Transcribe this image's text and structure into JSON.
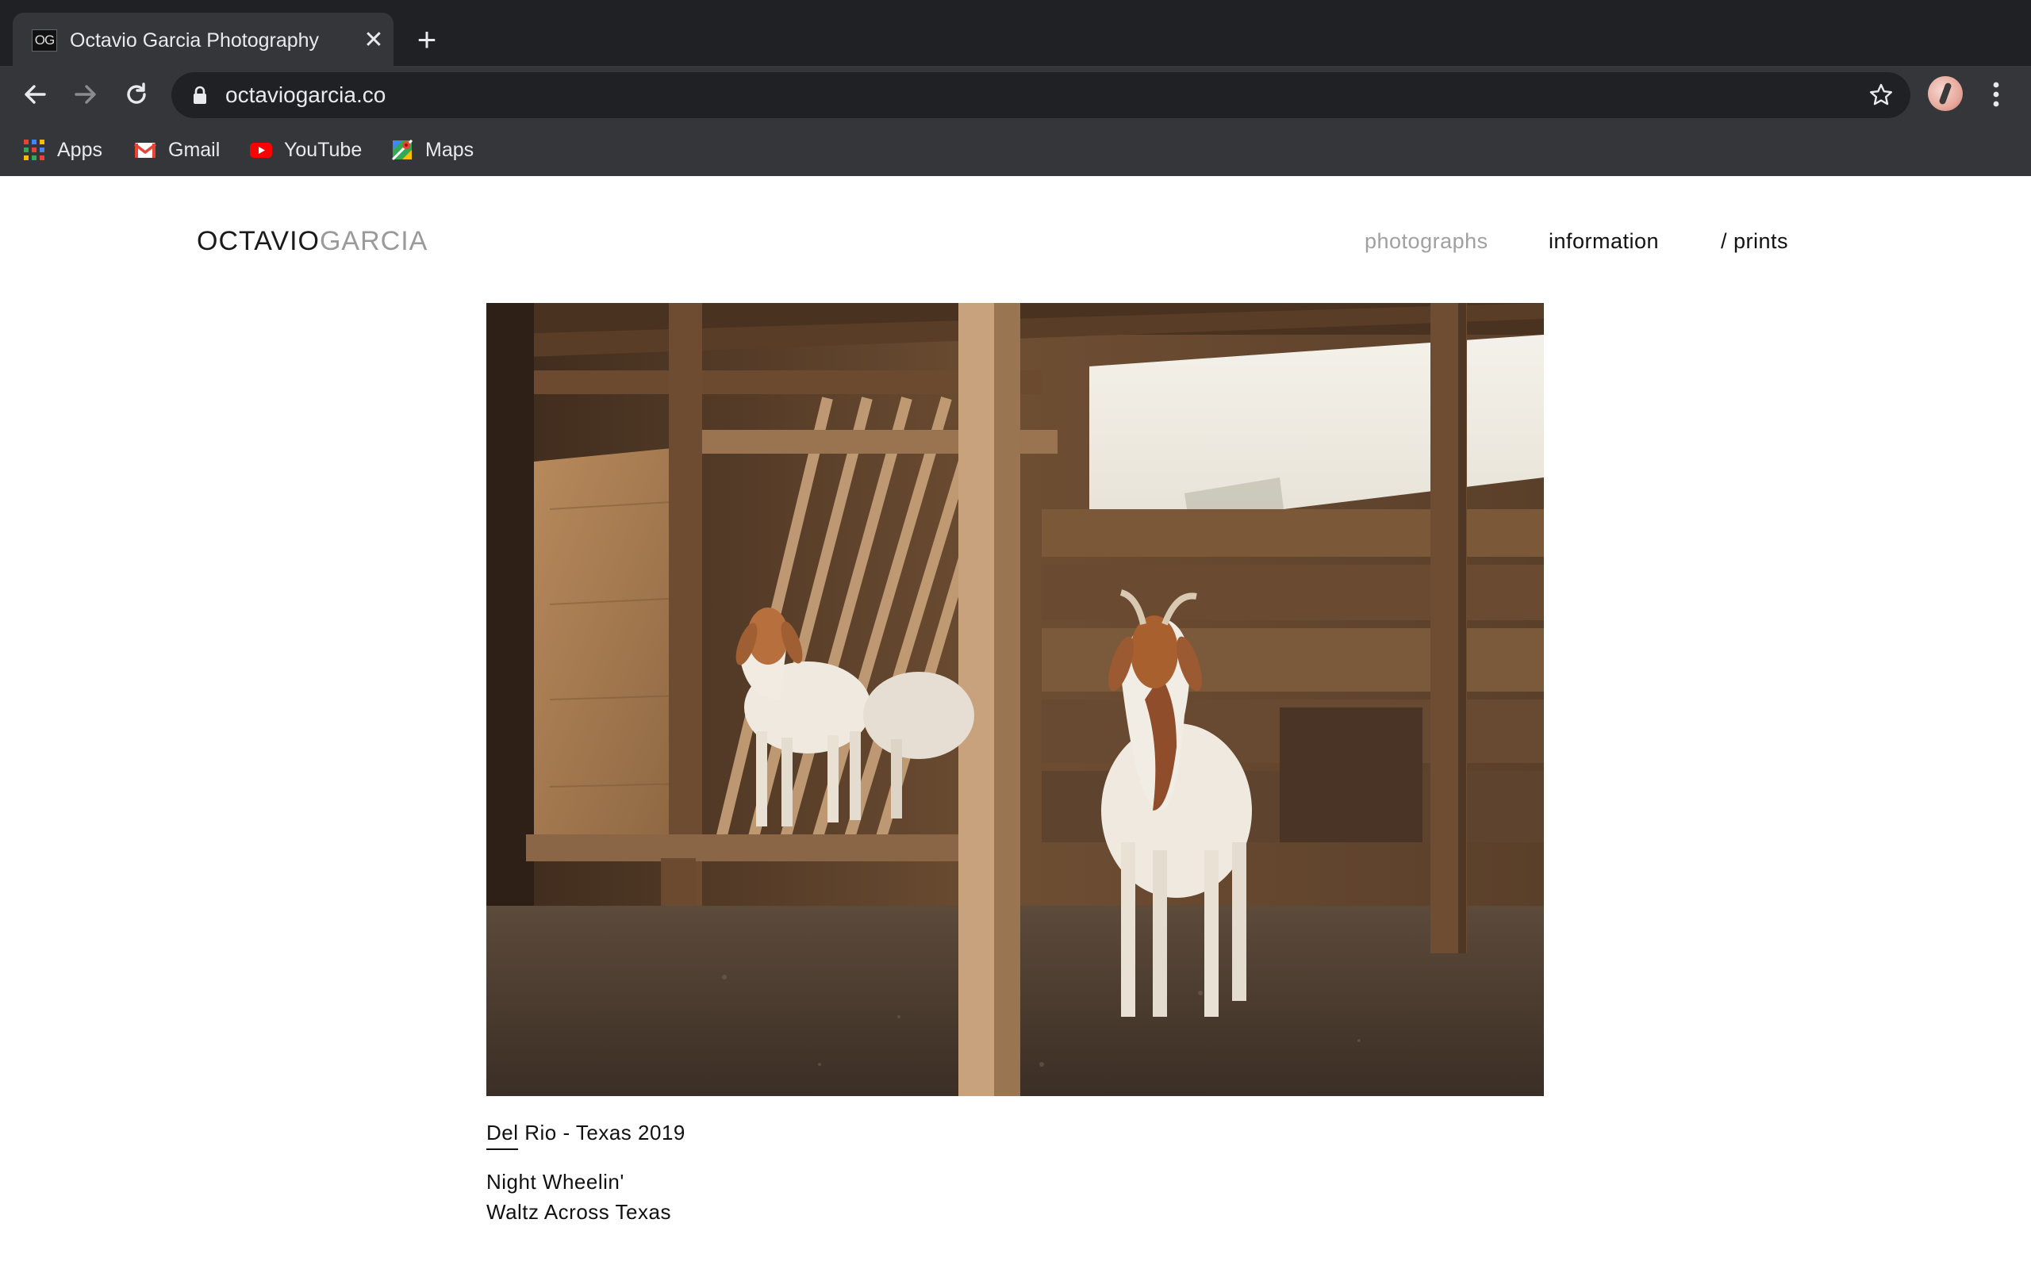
{
  "browser": {
    "tab": {
      "favicon_text": "OG",
      "title": "Octavio Garcia Photography"
    },
    "address": {
      "url": "octaviogarcia.co"
    },
    "bookmarks": [
      {
        "label": "Apps",
        "icon": "apps-grid-icon"
      },
      {
        "label": "Gmail",
        "icon": "gmail-icon"
      },
      {
        "label": "YouTube",
        "icon": "youtube-icon"
      },
      {
        "label": "Maps",
        "icon": "maps-icon"
      }
    ]
  },
  "site": {
    "logo": {
      "first": "OCTAVIO",
      "second": "GARCIA"
    },
    "nav": [
      {
        "label": "photographs",
        "active": true
      },
      {
        "label": "information",
        "active": false
      },
      {
        "label": "/ prints",
        "active": false
      }
    ],
    "photo": {
      "subject": "goats in a wooden barn"
    },
    "caption": {
      "location": "Del Rio - Texas 2019",
      "lines": [
        "Night Wheelin'",
        "Waltz Across Texas"
      ]
    }
  },
  "colors": {
    "tabstrip": "#202124",
    "toolbar": "#35363a",
    "logo_muted": "#9a9a9a",
    "nav_muted": "#a0a0a0"
  }
}
